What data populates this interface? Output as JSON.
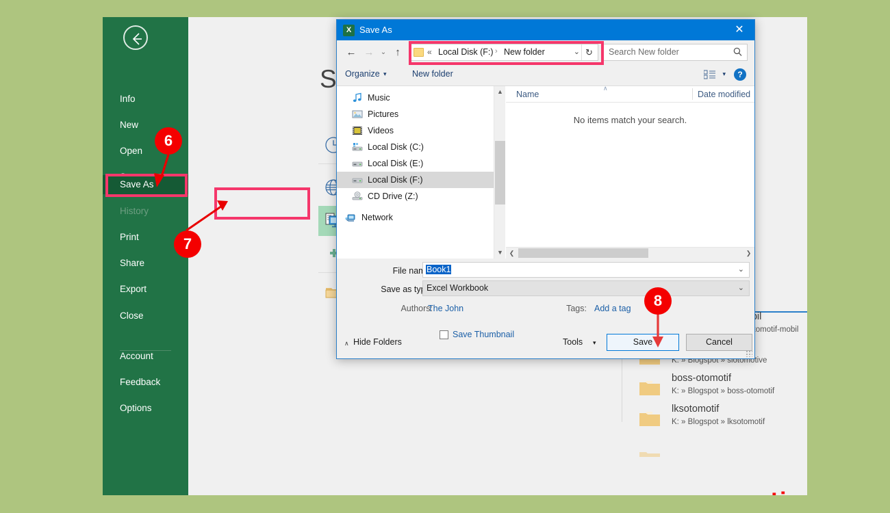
{
  "app": {
    "window_title": "Excel Backstage - Save As",
    "close_label": "✕"
  },
  "backstage": {
    "back_icon": "back-arrow-icon",
    "title": "Save As",
    "nav_items": [
      {
        "label": "Info",
        "state": "normal"
      },
      {
        "label": "New",
        "state": "normal"
      },
      {
        "label": "Open",
        "state": "normal"
      },
      {
        "label": "Save",
        "state": "normal"
      },
      {
        "label": "Save As",
        "state": "active"
      },
      {
        "label": "History",
        "state": "disabled"
      },
      {
        "label": "Print",
        "state": "normal"
      },
      {
        "label": "Share",
        "state": "normal"
      },
      {
        "label": "Export",
        "state": "normal"
      },
      {
        "label": "Close",
        "state": "normal"
      },
      {
        "label": "Account",
        "state": "normal"
      },
      {
        "label": "Feedback",
        "state": "normal"
      },
      {
        "label": "Options",
        "state": "normal"
      }
    ],
    "places": [
      {
        "label": "Recent",
        "icon": "clock-icon",
        "selected": false
      },
      {
        "label": "OneDrive",
        "icon": "globe-icon",
        "selected": false
      },
      {
        "label": "This PC",
        "icon": "computer-icon",
        "selected": true
      },
      {
        "label": "Add a Place",
        "icon": "plus-icon",
        "selected": false
      },
      {
        "label": "Browse",
        "icon": "folder-icon",
        "selected": false
      }
    ]
  },
  "bg_list": {
    "items": [
      {
        "name": "dunia-otomotif-mobil",
        "path": "K: » Blogspot » dunia-otomotif-mobil"
      },
      {
        "name": "siotomotive",
        "path": "K: » Blogspot » siotomotive"
      },
      {
        "name": "boss-otomotif",
        "path": "K: » Blogspot » boss-otomotif"
      },
      {
        "name": "lksotomotif",
        "path": "K: » Blogspot » lksotomotif"
      }
    ],
    "scroll_down_icon": "▼"
  },
  "watermark": {
    "text": "semutimut.com",
    "color": "#f50b0b"
  },
  "dialog": {
    "title": "Save As",
    "app_icon": "excel-icon",
    "app_icon_glyph": "X",
    "close_label": "✕",
    "nav": {
      "back_icon": "←",
      "forward_icon": "→",
      "recent_icon": "⌄",
      "up_icon": "↑"
    },
    "address": {
      "folder_icon": "folder-icon",
      "overflow_chevron": "«",
      "crumb1": "Local Disk (F:)",
      "separator": "›",
      "crumb2": "New folder",
      "dropdown_icon": "⌄",
      "refresh_icon": "↻"
    },
    "search": {
      "placeholder": "Search New folder",
      "icon": "search-icon"
    },
    "command_bar": {
      "organize": "Organize",
      "organize_caret": "▾",
      "new_folder": "New folder",
      "view_icon": "view-list-icon",
      "view_caret": "▾",
      "help_icon": "help-icon",
      "help_glyph": "?"
    },
    "tree": [
      {
        "label": "Music",
        "icon": "music-icon",
        "selected": false,
        "root": false
      },
      {
        "label": "Pictures",
        "icon": "picture-icon",
        "selected": false,
        "root": false
      },
      {
        "label": "Videos",
        "icon": "video-icon",
        "selected": false,
        "root": false
      },
      {
        "label": "Local Disk (C:)",
        "icon": "drive-system-icon",
        "selected": false,
        "root": false
      },
      {
        "label": "Local Disk (E:)",
        "icon": "drive-icon",
        "selected": false,
        "root": false
      },
      {
        "label": "Local Disk (F:)",
        "icon": "drive-icon",
        "selected": true,
        "root": false
      },
      {
        "label": "CD Drive (Z:)",
        "icon": "cd-drive-icon",
        "selected": false,
        "root": false
      },
      {
        "label": "Network",
        "icon": "network-icon",
        "selected": false,
        "root": true
      }
    ],
    "file_list": {
      "columns": [
        "Name",
        "Date modified"
      ],
      "sort_marker": "∧",
      "empty_message": "No items match your search.",
      "rows": []
    },
    "form": {
      "filename_label": "File name:",
      "filename_value": "Book1",
      "savetype_label": "Save as type:",
      "savetype_value": "Excel Workbook",
      "authors_label": "Authors:",
      "authors_value": "The John",
      "tags_label": "Tags:",
      "tags_value": "Add a tag",
      "save_thumbnail_label": "Save Thumbnail",
      "save_thumbnail_checked": false,
      "dropdown_caret": "⌄"
    },
    "footer": {
      "hide_folders_caret": "∧",
      "hide_folders_label": "Hide Folders",
      "tools_label": "Tools",
      "tools_caret": "▾",
      "save_label": "Save",
      "cancel_label": "Cancel"
    }
  },
  "scrollbars": {
    "up_arrow": "▲",
    "down_arrow": "▼",
    "left_arrow": "❮",
    "right_arrow": "❯"
  },
  "annotations": {
    "badges": [
      {
        "number": "6",
        "target": "Save As nav item"
      },
      {
        "number": "7",
        "target": "This PC place"
      },
      {
        "number": "8",
        "target": "Save button"
      }
    ],
    "highlight_color": "#f5376b",
    "badge_color": "#f40000"
  }
}
